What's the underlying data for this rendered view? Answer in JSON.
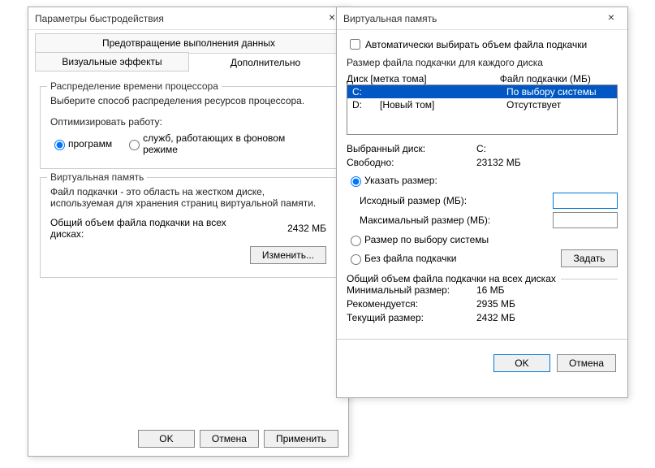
{
  "leftDialog": {
    "title": "Параметры быстродействия",
    "tabs": {
      "top": "Предотвращение выполнения данных",
      "visual": "Визуальные эффекты",
      "advanced": "Дополнительно"
    },
    "cpu": {
      "legend": "Распределение времени процессора",
      "desc": "Выберите способ распределения ресурсов процессора.",
      "optimize": "Оптимизировать работу:",
      "programs": "программ",
      "services": "служб, работающих в фоновом режиме"
    },
    "vm": {
      "legend": "Виртуальная память",
      "desc": "Файл подкачки - это область на жестком диске, используемая для хранения страниц виртуальной памяти.",
      "totalLabel": "Общий объем файла подкачки на всех дисках:",
      "totalValue": "2432 МБ",
      "change": "Изменить..."
    },
    "buttons": {
      "ok": "OK",
      "cancel": "Отмена",
      "apply": "Применить"
    }
  },
  "rightDialog": {
    "title": "Виртуальная память",
    "auto": "Автоматически выбирать объем файла подкачки",
    "perDrive": "Размер файла подкачки для каждого диска",
    "hdrDrive": "Диск [метка тома]",
    "hdrFile": "Файл подкачки (МБ)",
    "drives": [
      {
        "letter": "C:",
        "label": "",
        "file": "По выбору системы",
        "selected": true
      },
      {
        "letter": "D:",
        "label": "[Новый том]",
        "file": "Отсутствует",
        "selected": false
      }
    ],
    "selDrive": {
      "k": "Выбранный диск:",
      "v": "C:"
    },
    "free": {
      "k": "Свободно:",
      "v": "23132 МБ"
    },
    "custom": "Указать размер:",
    "initial": "Исходный размер (МБ):",
    "max": "Максимальный размер (МБ):",
    "system": "Размер по выбору системы",
    "none": "Без файла подкачки",
    "set": "Задать",
    "totalLegend": "Общий объем файла подкачки на всех дисках",
    "min": {
      "k": "Минимальный размер:",
      "v": "16 МБ"
    },
    "rec": {
      "k": "Рекомендуется:",
      "v": "2935 МБ"
    },
    "cur": {
      "k": "Текущий размер:",
      "v": "2432 МБ"
    },
    "ok": "OK",
    "cancel": "Отмена"
  }
}
